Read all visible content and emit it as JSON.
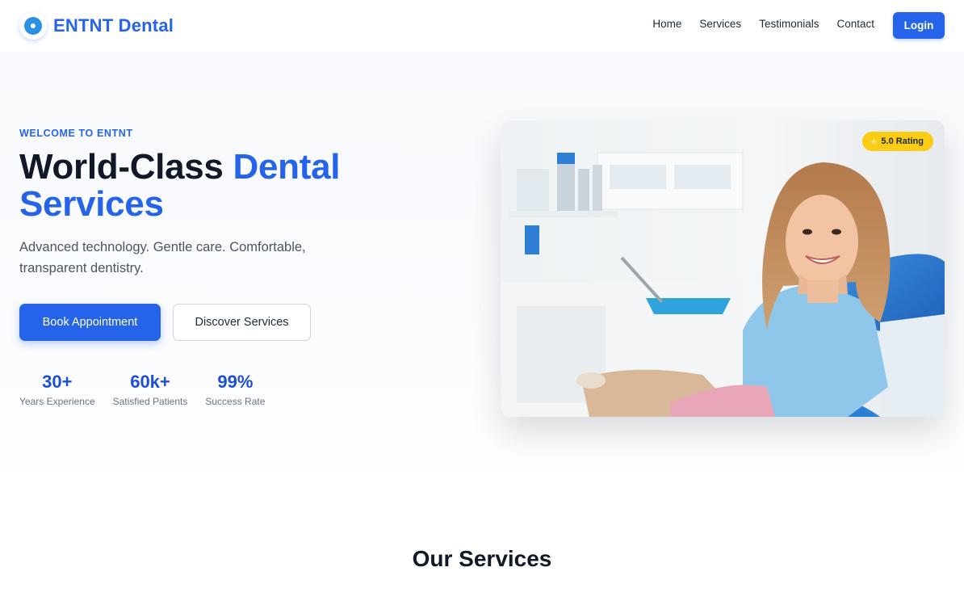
{
  "nav": {
    "brand": "ENTNT Dental",
    "links": [
      "Home",
      "Services",
      "Testimonials",
      "Contact"
    ],
    "login_label": "Login"
  },
  "hero": {
    "eyebrow": "WELCOME TO ENTNT",
    "headline_main": "World-Class ",
    "headline_accent": "Dental Services",
    "subtext": "Advanced technology. Gentle care. Comfortable, transparent dentistry.",
    "primary_button": "Book Appointment",
    "secondary_button": "Discover Services",
    "stats": [
      {
        "value": "30+",
        "label": "Years Experience"
      },
      {
        "value": "60k+",
        "label": "Satisfied Patients"
      },
      {
        "value": "99%",
        "label": "Success Rate"
      }
    ],
    "image_alt": "Smiling patient in dental chair",
    "rating_badge": "5.0 Rating"
  },
  "services": {
    "title": "Our Services"
  },
  "colors": {
    "accent": "#2563eb",
    "badge": "#facc15"
  },
  "icons": {
    "logo": "tooth-logo-icon",
    "rating": "star-icon"
  }
}
